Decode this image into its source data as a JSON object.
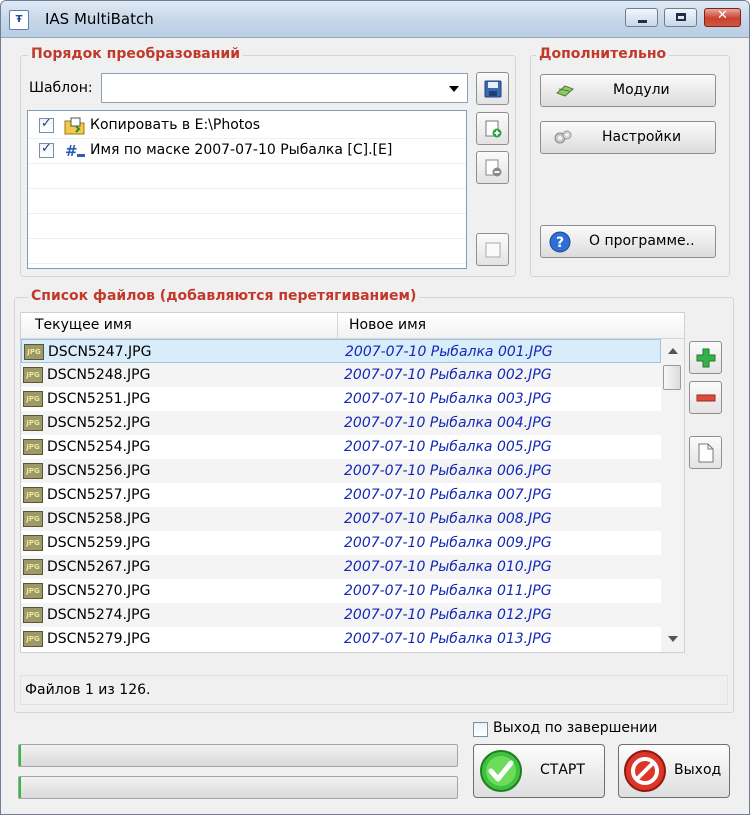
{
  "window": {
    "title": "IAS MultiBatch",
    "app_icon_glyph": "Ŧ",
    "minimize_glyph": "",
    "close_glyph": "✕"
  },
  "transforms_group": {
    "title": "Порядок преобразований",
    "template_label": "Шаблон:",
    "template_value": "",
    "items": [
      {
        "checked": true,
        "icon": "copy-folder-icon",
        "label": "Копировать в E:\\Photos"
      },
      {
        "checked": true,
        "icon": "rename-mask-icon",
        "label": "Имя по маске 2007-07-10 Рыбалка [C].[E]"
      }
    ]
  },
  "extra_group": {
    "title": "Дополнительно",
    "modules_label": "Модули",
    "settings_label": "Настройки",
    "about_label": "О программе.."
  },
  "files_group": {
    "title": "Список файлов (добавляются перетягиванием)",
    "columns": [
      "Текущее имя",
      "Новое имя"
    ],
    "selected_index": 0,
    "rows": [
      {
        "current": "DSCN5247.JPG",
        "new": "2007-07-10 Рыбалка 001.JPG"
      },
      {
        "current": "DSCN5248.JPG",
        "new": "2007-07-10 Рыбалка 002.JPG"
      },
      {
        "current": "DSCN5251.JPG",
        "new": "2007-07-10 Рыбалка 003.JPG"
      },
      {
        "current": "DSCN5252.JPG",
        "new": "2007-07-10 Рыбалка 004.JPG"
      },
      {
        "current": "DSCN5254.JPG",
        "new": "2007-07-10 Рыбалка 005.JPG"
      },
      {
        "current": "DSCN5256.JPG",
        "new": "2007-07-10 Рыбалка 006.JPG"
      },
      {
        "current": "DSCN5257.JPG",
        "new": "2007-07-10 Рыбалка 007.JPG"
      },
      {
        "current": "DSCN5258.JPG",
        "new": "2007-07-10 Рыбалка 008.JPG"
      },
      {
        "current": "DSCN5259.JPG",
        "new": "2007-07-10 Рыбалка 009.JPG"
      },
      {
        "current": "DSCN5267.JPG",
        "new": "2007-07-10 Рыбалка 010.JPG"
      },
      {
        "current": "DSCN5270.JPG",
        "new": "2007-07-10 Рыбалка 011.JPG"
      },
      {
        "current": "DSCN5274.JPG",
        "new": "2007-07-10 Рыбалка 012.JPG"
      },
      {
        "current": "DSCN5279.JPG",
        "new": "2007-07-10 Рыбалка 013.JPG"
      }
    ],
    "file_icon_text": "JPG"
  },
  "status": {
    "text": "Файлов 1 из 126."
  },
  "bottom": {
    "exit_on_finish_label": "Выход по завершении",
    "exit_on_finish_checked": false,
    "start_label": "СТАРТ",
    "exit_label": "Выход",
    "progress": [
      0.005,
      0.005
    ]
  },
  "colors": {
    "group_title": "#c0392b",
    "new_name": "#1428b8",
    "progress_fill": "#2bbf3b",
    "selection": "#d9ecfa"
  }
}
